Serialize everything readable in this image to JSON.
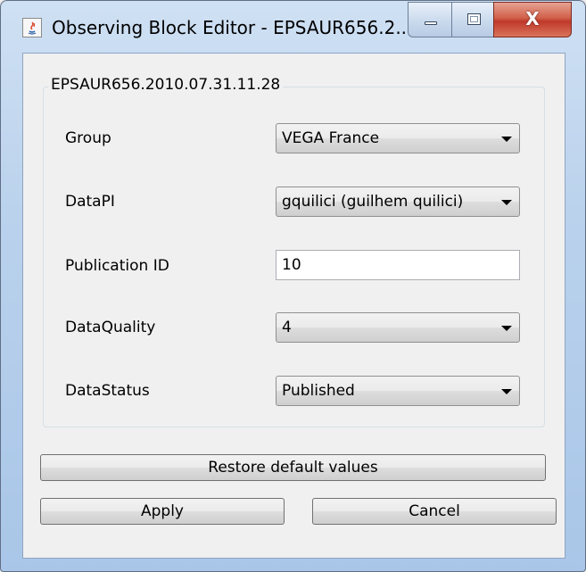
{
  "window": {
    "title": "Observing Block Editor - EPSAUR656.2...",
    "app_icon": "java-icon",
    "close_glyph": "X"
  },
  "form": {
    "group_title": "EPSAUR656.2010.07.31.11.28",
    "fields": {
      "group": {
        "label": "Group",
        "value": "VEGA France"
      },
      "datapi": {
        "label": "DataPI",
        "value": "gquilici (guilhem quilici)"
      },
      "publication_id": {
        "label": "Publication ID",
        "value": "10"
      },
      "dataquality": {
        "label": "DataQuality",
        "value": "4"
      },
      "datastatus": {
        "label": "DataStatus",
        "value": "Published"
      }
    }
  },
  "buttons": {
    "restore": "Restore default values",
    "apply": "Apply",
    "cancel": "Cancel"
  },
  "colors": {
    "close_button": "#c0392b",
    "title_bar": "#b9d1ec",
    "client_bg": "#f0f0f0"
  }
}
